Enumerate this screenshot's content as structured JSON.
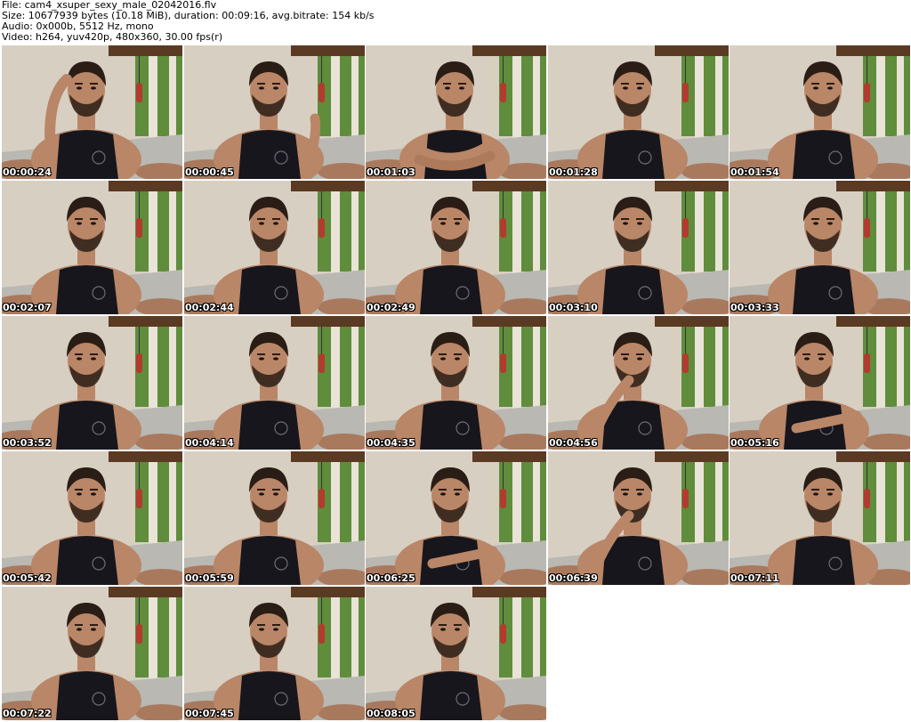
{
  "header": {
    "file": "File: cam4_xsuper_sexy_male_02042016.flv",
    "size": "Size: 10677939 bytes (10.18 MiB), duration: 00:09:16, avg.bitrate: 154 kb/s",
    "audio": "Audio: 0x000b, 5512 Hz, mono",
    "video": "Video: h264, yuv420p, 480x360, 30.00 fps(r)"
  },
  "thumbnails": [
    {
      "timestamp": "00:00:24",
      "pose": "hand-head"
    },
    {
      "timestamp": "00:00:45",
      "pose": "gesture"
    },
    {
      "timestamp": "00:01:03",
      "pose": "arms-crossed"
    },
    {
      "timestamp": "00:01:28",
      "pose": "arms-down"
    },
    {
      "timestamp": "00:01:54",
      "pose": "close"
    },
    {
      "timestamp": "00:02:07",
      "pose": "lean"
    },
    {
      "timestamp": "00:02:44",
      "pose": "lean"
    },
    {
      "timestamp": "00:02:49",
      "pose": "lean"
    },
    {
      "timestamp": "00:03:10",
      "pose": "lean"
    },
    {
      "timestamp": "00:03:33",
      "pose": "close"
    },
    {
      "timestamp": "00:03:52",
      "pose": "lean"
    },
    {
      "timestamp": "00:04:14",
      "pose": "lean"
    },
    {
      "timestamp": "00:04:35",
      "pose": "lean"
    },
    {
      "timestamp": "00:04:56",
      "pose": "hand-mouth"
    },
    {
      "timestamp": "00:05:16",
      "pose": "arm-across"
    },
    {
      "timestamp": "00:05:42",
      "pose": "lean"
    },
    {
      "timestamp": "00:05:59",
      "pose": "lean"
    },
    {
      "timestamp": "00:06:25",
      "pose": "arm-across"
    },
    {
      "timestamp": "00:06:39",
      "pose": "hand-mouth"
    },
    {
      "timestamp": "00:07:11",
      "pose": "close"
    },
    {
      "timestamp": "00:07:22",
      "pose": "lean"
    },
    {
      "timestamp": "00:07:45",
      "pose": "lean"
    },
    {
      "timestamp": "00:08:05",
      "pose": "lean"
    }
  ],
  "colors": {
    "page_background": "#ffffff",
    "header_text": "#000000",
    "timestamp_text": "#ffffff",
    "wall": "#d8cfc3",
    "floor": "#b9b8b2",
    "pillar": "#e9e3d8",
    "roof": "#5a3a22",
    "foliage": "#5f8d3b",
    "skin": "#b98667",
    "hair": "#2a1d16",
    "tanktop": "#17161c",
    "punching_bag": "#b33a2e"
  }
}
